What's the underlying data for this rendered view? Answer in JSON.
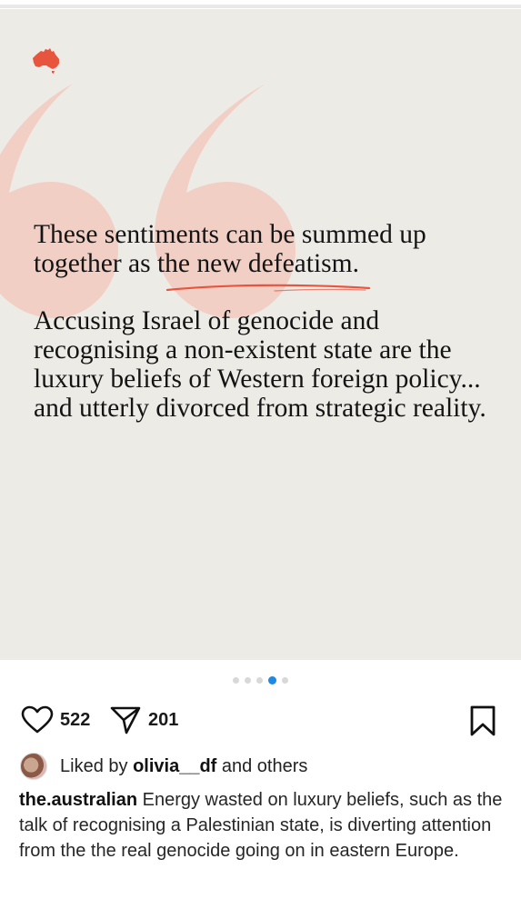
{
  "post": {
    "quote": {
      "line_a": "These sentiments can be summed up",
      "line_b_prefix": "together as ",
      "line_b_highlight": "the new defeatism.",
      "paragraph2": "Accusing Israel of genocide and recognising a non-existent state are the luxury beliefs of Western foreign policy... and utterly divorced from strategic reality."
    },
    "logo_icon": "australia-map-icon",
    "accent_color": "#e8553f",
    "quote_mark_color": "#f2cfc5",
    "carousel": {
      "total": 5,
      "active": 4
    },
    "actions": {
      "likes": "522",
      "shares": "201"
    },
    "liked_by": {
      "prefix": "Liked by ",
      "user": "olivia__df",
      "suffix": " and others"
    },
    "caption": {
      "username": "the.australian",
      "text": " Energy wasted on luxury beliefs, such as the talk of recognising a Palestinian state, is diverting attention from the the real genocide going on in eastern Europe."
    }
  }
}
